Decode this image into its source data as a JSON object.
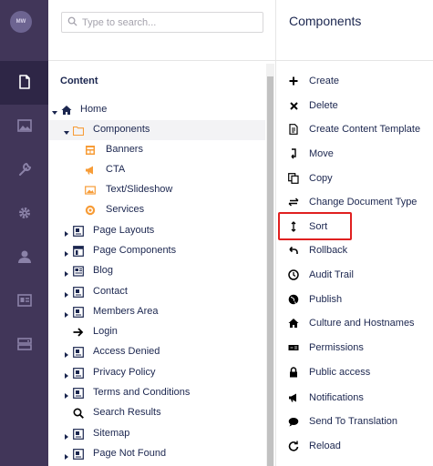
{
  "user": {
    "initials": "MW"
  },
  "sections": [
    {
      "name": "content",
      "icon": "document-icon",
      "active": true
    },
    {
      "name": "media",
      "icon": "image-icon"
    },
    {
      "name": "settings",
      "icon": "wrench-icon"
    },
    {
      "name": "packages",
      "icon": "gear-icon"
    },
    {
      "name": "users",
      "icon": "user-icon"
    },
    {
      "name": "members",
      "icon": "id-card-icon"
    },
    {
      "name": "forms",
      "icon": "form-icon"
    }
  ],
  "search": {
    "placeholder": "Type to search..."
  },
  "tree": {
    "title": "Content",
    "nodes": [
      {
        "label": "Home",
        "icon": "home-icon"
      },
      {
        "label": "Components",
        "icon": "folder-icon",
        "selected": true
      },
      {
        "label": "Banners",
        "icon": "banner-icon"
      },
      {
        "label": "CTA",
        "icon": "megaphone-icon"
      },
      {
        "label": "Text/Slideshow",
        "icon": "picture-icon"
      },
      {
        "label": "Services",
        "icon": "target-icon"
      },
      {
        "label": "Page Layouts",
        "icon": "page-icon"
      },
      {
        "label": "Page Components",
        "icon": "layout-icon"
      },
      {
        "label": "Blog",
        "icon": "newspaper-icon"
      },
      {
        "label": "Contact",
        "icon": "page-icon"
      },
      {
        "label": "Members Area",
        "icon": "page-icon"
      },
      {
        "label": "Login",
        "icon": "arrow-right-icon"
      },
      {
        "label": "Access Denied",
        "icon": "page-icon"
      },
      {
        "label": "Privacy Policy",
        "icon": "page-icon"
      },
      {
        "label": "Terms and Conditions",
        "icon": "page-icon"
      },
      {
        "label": "Search Results",
        "icon": "search-icon"
      },
      {
        "label": "Sitemap",
        "icon": "page-icon"
      },
      {
        "label": "Page Not Found",
        "icon": "page-icon"
      }
    ]
  },
  "actions": {
    "title": "Components",
    "items": [
      {
        "label": "Create",
        "icon": "plus-icon"
      },
      {
        "label": "Delete",
        "icon": "x-icon"
      },
      {
        "label": "Create Content Template",
        "icon": "template-icon"
      },
      {
        "label": "Move",
        "icon": "move-icon"
      },
      {
        "label": "Copy",
        "icon": "copy-icon"
      },
      {
        "label": "Change Document Type",
        "icon": "swap-icon"
      },
      {
        "label": "Sort",
        "icon": "sort-icon",
        "highlighted": true
      },
      {
        "label": "Rollback",
        "icon": "rollback-icon"
      },
      {
        "label": "Audit Trail",
        "icon": "clock-icon"
      },
      {
        "label": "Publish",
        "icon": "globe-icon"
      },
      {
        "label": "Culture and Hostnames",
        "icon": "home-icon"
      },
      {
        "label": "Permissions",
        "icon": "permissions-icon"
      },
      {
        "label": "Public access",
        "icon": "lock-icon"
      },
      {
        "label": "Notifications",
        "icon": "megaphone-icon"
      },
      {
        "label": "Send To Translation",
        "icon": "chat-icon"
      },
      {
        "label": "Reload",
        "icon": "reload-icon"
      }
    ]
  },
  "colors": {
    "rail": "#413659",
    "accent_orange": "#f79c37",
    "highlight": "#e02020"
  }
}
